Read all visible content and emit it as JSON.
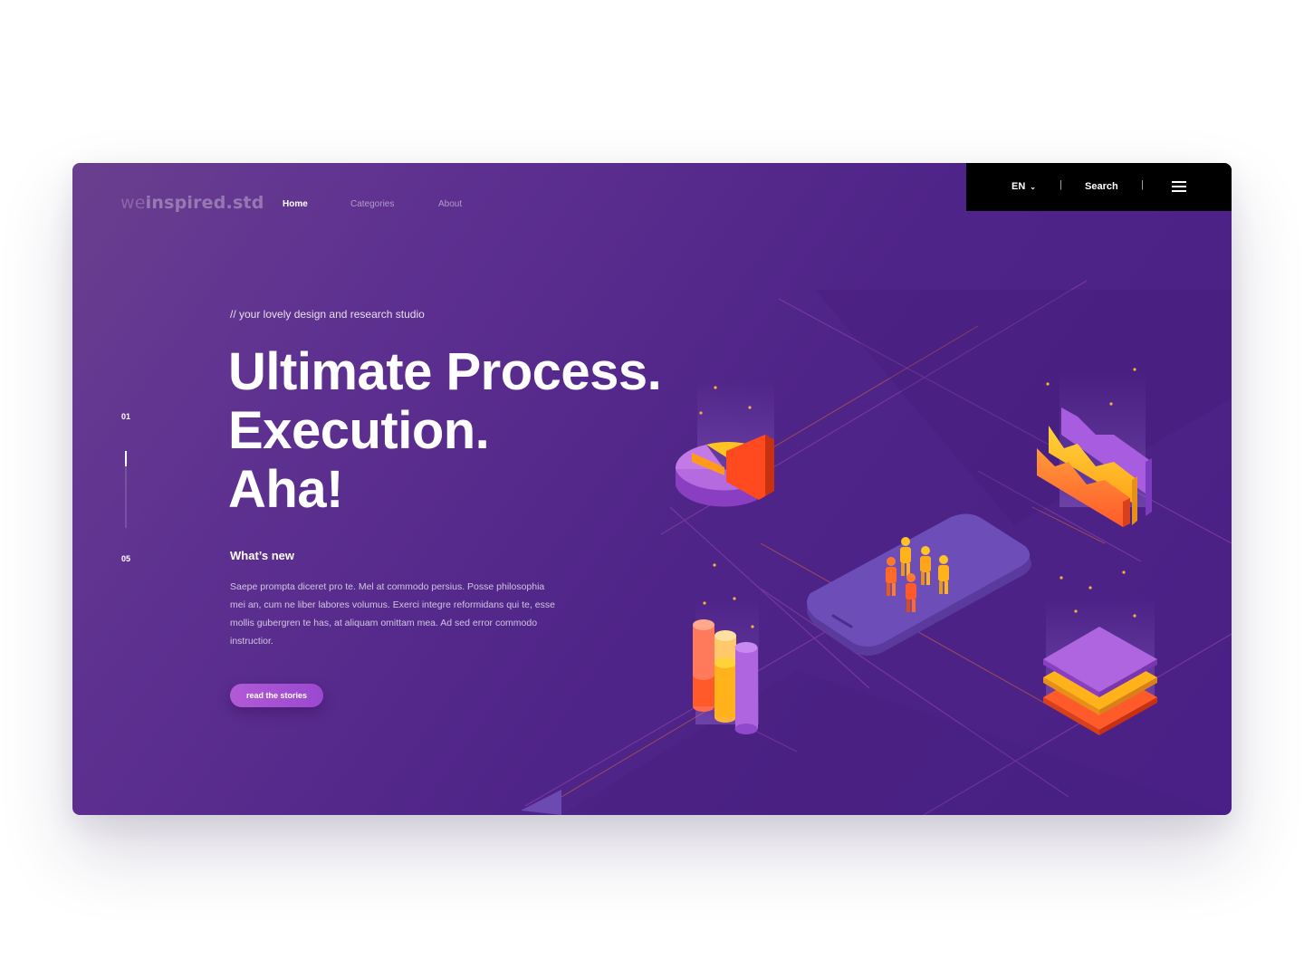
{
  "brand": {
    "logo_light": "we",
    "logo_bold": "inspired.std"
  },
  "nav": {
    "items": [
      "Home",
      "Categories",
      "About"
    ],
    "active": "Home"
  },
  "topbar": {
    "lang": "EN",
    "search": "Search",
    "separator": "|"
  },
  "slider": {
    "current": "01",
    "total": "05",
    "progress_fraction": 0.2
  },
  "hero": {
    "eyebrow": "// your lovely design and research studio",
    "headline": [
      "Ultimate Process.",
      "Execution.",
      "Aha!"
    ]
  },
  "news": {
    "title": "What’s new",
    "body": "Saepe prompta diceret pro te. Mel at commodo persius. Posse philosophia mei an, cum ne liber labores volumus. Exerci integre reformidans qui te, esse mollis gubergren te has, at aliquam omittam mea. Ad sed error commodo instructior.",
    "cta": "read the stories"
  },
  "icons": {
    "lang_dropdown": "chevron-down-icon",
    "menu": "hamburger-menu-icon",
    "illustration": [
      "pie-chart-illustration",
      "area-chart-illustration",
      "phone-with-people-illustration",
      "cylinder-bars-illustration",
      "layer-stack-illustration"
    ]
  },
  "colors": {
    "background_purple": "#54268a",
    "topbar": "#000000",
    "cta_start": "#b25ad6",
    "cta_end": "#9a48cf",
    "accent_orange": "#ff6a2a",
    "accent_yellow": "#ffb21a"
  }
}
